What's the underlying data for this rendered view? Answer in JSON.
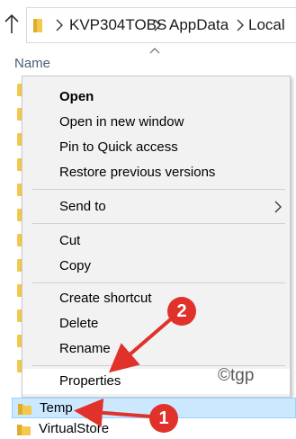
{
  "address_bar": {
    "path": [
      "KVP304TOBS",
      "AppData",
      "Local"
    ],
    "up_icon": "up-arrow-icon",
    "folder_icon": "folder-icon",
    "separator_icon": "chevron-right-icon"
  },
  "file_list": {
    "column_header": "Name",
    "sort_icon": "sort-ascending-caret-icon",
    "items": [
      {
        "name": "Temp",
        "selected": true
      },
      {
        "name": "VirtualStore",
        "selected": false
      }
    ]
  },
  "context_menu": {
    "groups": [
      [
        {
          "label": "Open",
          "bold": true
        },
        {
          "label": "Open in new window"
        },
        {
          "label": "Pin to Quick access"
        },
        {
          "label": "Restore previous versions"
        }
      ],
      [
        {
          "label": "Send to",
          "has_submenu": true
        }
      ],
      [
        {
          "label": "Cut"
        },
        {
          "label": "Copy"
        }
      ],
      [
        {
          "label": "Create shortcut"
        },
        {
          "label": "Delete"
        },
        {
          "label": "Rename"
        }
      ],
      [
        {
          "label": "Properties",
          "highlighted": true
        }
      ]
    ]
  },
  "annotations": {
    "badges": [
      "1",
      "2"
    ],
    "badge_color": "#e0322b",
    "arrow_color": "#e0322b"
  },
  "watermark": "©tgp",
  "colors": {
    "selection_fill": "#cce8ff",
    "selection_border": "#99d1ff",
    "menu_background": "#f2f2f2",
    "folder_yellow": "#f2c94c",
    "header_text": "#4c607a"
  }
}
